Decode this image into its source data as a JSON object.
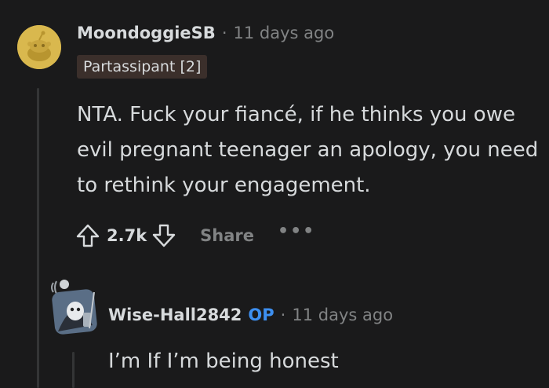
{
  "comment1": {
    "username": "MoondoggieSB",
    "separator": "·",
    "timestamp": "11 days ago",
    "flair": "Partassipant [2]",
    "body": "NTA. Fuck your fiancé, if he thinks you owe evil pregnant teenager an apology, you need to rethink your engagement.",
    "score": "2.7k",
    "share_label": "Share",
    "more_label": "•••",
    "avatar_color": "#d9b84e"
  },
  "comment2": {
    "username": "Wise-Hall2842",
    "op_label": "OP",
    "separator": "·",
    "timestamp": "11 days ago",
    "body": "I’m If I’m being honest"
  },
  "colors": {
    "background": "#1a1a1b",
    "text": "#d7dadc",
    "muted": "#818384",
    "op_blue": "#3d8ff0",
    "thread_line": "#343536"
  }
}
